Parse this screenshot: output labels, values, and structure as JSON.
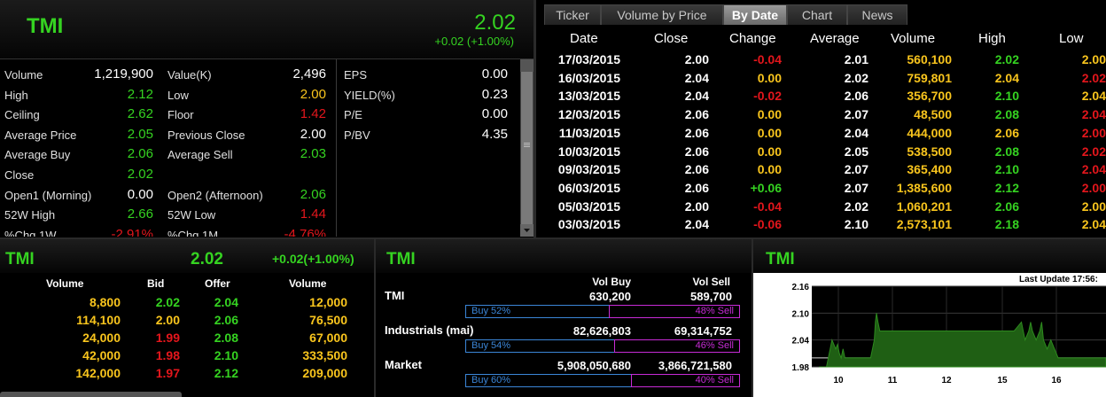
{
  "header": {
    "symbol": "TMI",
    "price": "2.02",
    "change": "+0.02 (+1.00%)"
  },
  "stats_left": [
    {
      "label": "Volume",
      "value": "1,219,900",
      "color": "w"
    },
    {
      "label": "High",
      "value": "2.12",
      "color": "g"
    },
    {
      "label": "Ceiling",
      "value": "2.62",
      "color": "g"
    },
    {
      "label": "Average Price",
      "value": "2.05",
      "color": "g"
    },
    {
      "label": "Average Buy",
      "value": "2.06",
      "color": "g"
    },
    {
      "label": "Close",
      "value": "2.02",
      "color": "g"
    },
    {
      "label": "Open1 (Morning)",
      "value": "0.00",
      "color": "w"
    },
    {
      "label": "52W High",
      "value": "2.66",
      "color": "g"
    },
    {
      "label": "%Chg 1W",
      "value": "-2.91%",
      "color": "r"
    }
  ],
  "stats_mid": [
    {
      "label": "Value(K)",
      "value": "2,496",
      "color": "w"
    },
    {
      "label": "Low",
      "value": "2.00",
      "color": "y"
    },
    {
      "label": "Floor",
      "value": "1.42",
      "color": "r"
    },
    {
      "label": "Previous Close",
      "value": "2.00",
      "color": "w"
    },
    {
      "label": "Average Sell",
      "value": "2.03",
      "color": "g"
    },
    {
      "label": "",
      "value": "",
      "color": "w"
    },
    {
      "label": "Open2 (Afternoon)",
      "value": "2.06",
      "color": "g"
    },
    {
      "label": "52W Low",
      "value": "1.44",
      "color": "r"
    },
    {
      "label": "%Chg 1M",
      "value": "-4.76%",
      "color": "r"
    }
  ],
  "stats_right": [
    {
      "label": "EPS",
      "value": "0.00"
    },
    {
      "label": "YIELD(%)",
      "value": "0.23"
    },
    {
      "label": "P/E",
      "value": "0.00"
    },
    {
      "label": "P/BV",
      "value": "4.35"
    }
  ],
  "tabs": [
    {
      "label": "Ticker",
      "active": false
    },
    {
      "label": "Volume by Price",
      "active": false
    },
    {
      "label": "By Date",
      "active": true
    },
    {
      "label": "Chart",
      "active": false
    },
    {
      "label": "News",
      "active": false
    }
  ],
  "bydate": {
    "headers": [
      "Date",
      "Close",
      "Change",
      "Average",
      "Volume",
      "High",
      "Low"
    ],
    "rows": [
      {
        "date": "17/03/2015",
        "close": "2.00",
        "change": "-0.04",
        "cc": "r",
        "avg": "2.01",
        "vol": "560,100",
        "high": "2.02",
        "hc": "g",
        "low": "2.00",
        "lc": "y"
      },
      {
        "date": "16/03/2015",
        "close": "2.04",
        "change": "0.00",
        "cc": "y",
        "avg": "2.02",
        "vol": "759,801",
        "high": "2.04",
        "hc": "y",
        "low": "2.02",
        "lc": "r"
      },
      {
        "date": "13/03/2015",
        "close": "2.04",
        "change": "-0.02",
        "cc": "r",
        "avg": "2.06",
        "vol": "356,700",
        "high": "2.10",
        "hc": "g",
        "low": "2.04",
        "lc": "y"
      },
      {
        "date": "12/03/2015",
        "close": "2.06",
        "change": "0.00",
        "cc": "y",
        "avg": "2.07",
        "vol": "48,500",
        "high": "2.08",
        "hc": "g",
        "low": "2.04",
        "lc": "r"
      },
      {
        "date": "11/03/2015",
        "close": "2.06",
        "change": "0.00",
        "cc": "y",
        "avg": "2.04",
        "vol": "444,000",
        "high": "2.06",
        "hc": "y",
        "low": "2.00",
        "lc": "r"
      },
      {
        "date": "10/03/2015",
        "close": "2.06",
        "change": "0.00",
        "cc": "y",
        "avg": "2.05",
        "vol": "538,500",
        "high": "2.08",
        "hc": "g",
        "low": "2.02",
        "lc": "r"
      },
      {
        "date": "09/03/2015",
        "close": "2.06",
        "change": "0.00",
        "cc": "y",
        "avg": "2.07",
        "vol": "365,400",
        "high": "2.10",
        "hc": "g",
        "low": "2.04",
        "lc": "r"
      },
      {
        "date": "06/03/2015",
        "close": "2.06",
        "change": "+0.06",
        "cc": "g",
        "avg": "2.07",
        "vol": "1,385,600",
        "high": "2.12",
        "hc": "g",
        "low": "2.00",
        "lc": "r"
      },
      {
        "date": "05/03/2015",
        "close": "2.00",
        "change": "-0.04",
        "cc": "r",
        "avg": "2.02",
        "vol": "1,060,201",
        "high": "2.06",
        "hc": "g",
        "low": "2.00",
        "lc": "y"
      },
      {
        "date": "03/03/2015",
        "close": "2.04",
        "change": "-0.06",
        "cc": "r",
        "avg": "2.10",
        "vol": "2,573,101",
        "high": "2.18",
        "hc": "g",
        "low": "2.04",
        "lc": "y"
      }
    ]
  },
  "orderbook": {
    "symbol": "TMI",
    "price": "2.02",
    "change": "+0.02(+1.00%)",
    "headers": [
      "Volume",
      "Bid",
      "Offer",
      "Volume"
    ],
    "rows": [
      {
        "bv": "8,800",
        "bid": "2.02",
        "bc": "g",
        "offer": "2.04",
        "oc": "g",
        "ov": "12,000"
      },
      {
        "bv": "114,100",
        "bid": "2.00",
        "bc": "y",
        "offer": "2.06",
        "oc": "g",
        "ov": "76,500"
      },
      {
        "bv": "24,000",
        "bid": "1.99",
        "bc": "r",
        "offer": "2.08",
        "oc": "g",
        "ov": "67,000"
      },
      {
        "bv": "42,000",
        "bid": "1.98",
        "bc": "r",
        "offer": "2.10",
        "oc": "g",
        "ov": "333,500"
      },
      {
        "bv": "142,000",
        "bid": "1.97",
        "bc": "r",
        "offer": "2.12",
        "oc": "g",
        "ov": "209,000"
      }
    ]
  },
  "volbuysell": {
    "title": "TMI",
    "col_buy": "Vol Buy",
    "col_sell": "Vol Sell",
    "rows": [
      {
        "label": "TMI",
        "buy": "630,200",
        "sell": "589,700",
        "buy_pct": 52,
        "buy_lbl": "Buy  52%",
        "sell_lbl": "48%  Sell"
      },
      {
        "label": "Industrials (mai)",
        "buy": "82,626,803",
        "sell": "69,314,752",
        "buy_pct": 54,
        "buy_lbl": "Buy  54%",
        "sell_lbl": "46%  Sell"
      },
      {
        "label": "Market",
        "buy": "5,908,050,680",
        "sell": "3,866,721,580",
        "buy_pct": 60,
        "buy_lbl": "Buy  60%",
        "sell_lbl": "40%  Sell"
      }
    ]
  },
  "chart_data": {
    "type": "area",
    "title": "TMI",
    "subtitle": "Last Update 17:56:",
    "ylim": [
      1.98,
      2.16
    ],
    "yticks": [
      "2.16",
      "2.10",
      "2.04",
      "1.98"
    ],
    "xticks": [
      "10",
      "11",
      "12",
      "15",
      "16"
    ],
    "baseline": 2.0,
    "x": [
      9.5,
      9.6,
      9.7,
      9.75,
      9.8,
      9.85,
      9.9,
      9.95,
      10.0,
      10.05,
      10.1,
      10.15,
      10.2,
      10.3,
      10.4,
      10.5,
      10.55,
      10.6,
      10.7,
      10.8,
      10.9,
      11.0,
      11.03,
      11.06,
      11.1,
      11.15,
      11.2,
      11.3,
      11.5,
      11.7,
      12.0,
      12.3,
      12.6,
      12.8,
      13.0,
      13.2,
      13.4,
      13.6,
      13.8,
      14.0,
      14.3,
      14.6,
      14.8,
      15.0,
      15.05,
      15.1,
      15.2,
      15.25,
      15.3,
      15.4,
      15.5,
      15.55,
      15.6,
      15.7,
      15.8,
      15.9,
      16.0,
      16.1,
      16.2,
      16.5,
      16.9,
      17.3
    ],
    "values": [
      1.98,
      1.98,
      1.98,
      2.0,
      2.02,
      2.04,
      2.03,
      2.02,
      2.03,
      2.01,
      2.0,
      2.02,
      2.0,
      2.0,
      2.0,
      2.0,
      2.0,
      2.0,
      2.0,
      2.0,
      2.0,
      2.04,
      2.08,
      2.1,
      2.08,
      2.06,
      2.06,
      2.06,
      2.06,
      2.06,
      2.06,
      2.06,
      2.06,
      2.06,
      2.06,
      2.06,
      2.06,
      2.06,
      2.06,
      2.06,
      2.06,
      2.06,
      2.06,
      2.08,
      2.06,
      2.04,
      2.06,
      2.08,
      2.06,
      2.04,
      2.06,
      2.08,
      2.04,
      2.02,
      2.04,
      2.02,
      2.0,
      2.0,
      2.0,
      2.0,
      2.0,
      2.0
    ],
    "color": "#1f5f14"
  }
}
